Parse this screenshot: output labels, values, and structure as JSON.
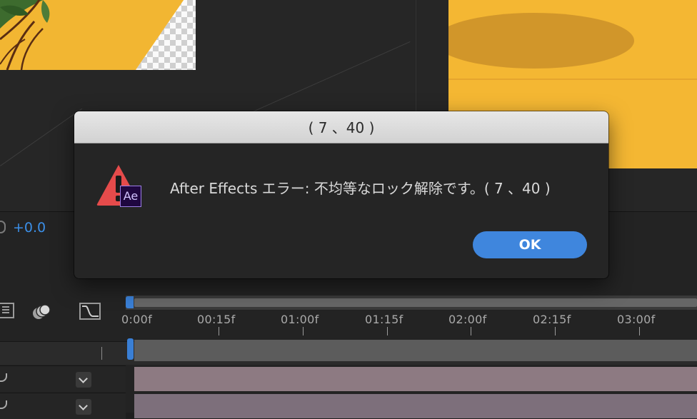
{
  "viewer": {
    "offset_value": "+0.0"
  },
  "timeline": {
    "ticks": [
      "0:00f",
      "00:15f",
      "01:00f",
      "01:15f",
      "02:00f",
      "02:15f",
      "03:00f"
    ]
  },
  "dialog": {
    "title": "( 7 、40 )",
    "badge": "Ae",
    "message": "After Effects エラー: 不均等なロック解除です。( 7 、40 )",
    "ok_label": "OK"
  },
  "colors": {
    "accent": "#3f86dd",
    "warning": "#e54b4b",
    "ae_purple": "#1f0740"
  }
}
